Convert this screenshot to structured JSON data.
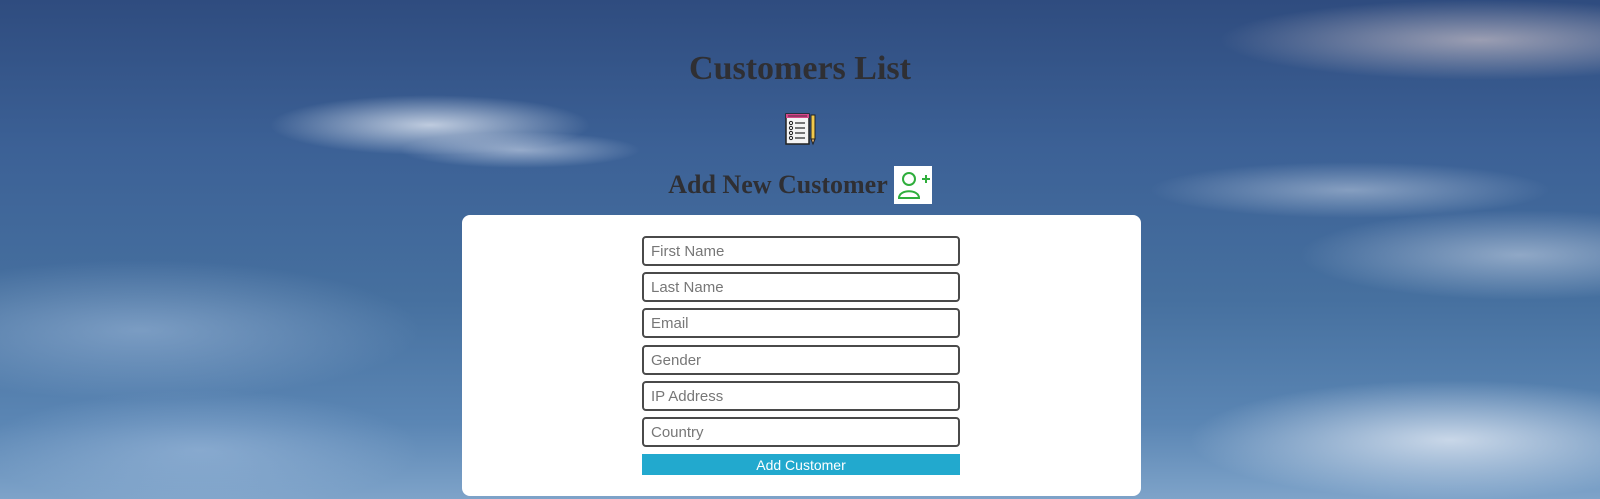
{
  "header": {
    "title": "Customers List",
    "subtitle": "Add New Customer"
  },
  "icons": {
    "list": "clipboard-list-icon",
    "add_user": "add-user-icon"
  },
  "form": {
    "fields": [
      {
        "name": "first-name",
        "placeholder": "First Name",
        "value": ""
      },
      {
        "name": "last-name",
        "placeholder": "Last Name",
        "value": ""
      },
      {
        "name": "email",
        "placeholder": "Email",
        "value": ""
      },
      {
        "name": "gender",
        "placeholder": "Gender",
        "value": ""
      },
      {
        "name": "ip-address",
        "placeholder": "IP Address",
        "value": ""
      },
      {
        "name": "country",
        "placeholder": "Country",
        "value": ""
      }
    ],
    "submit_label": "Add Customer"
  },
  "colors": {
    "button": "#22a9ce",
    "heading": "#2f2f33",
    "add_user_icon": "#2fae3c"
  }
}
